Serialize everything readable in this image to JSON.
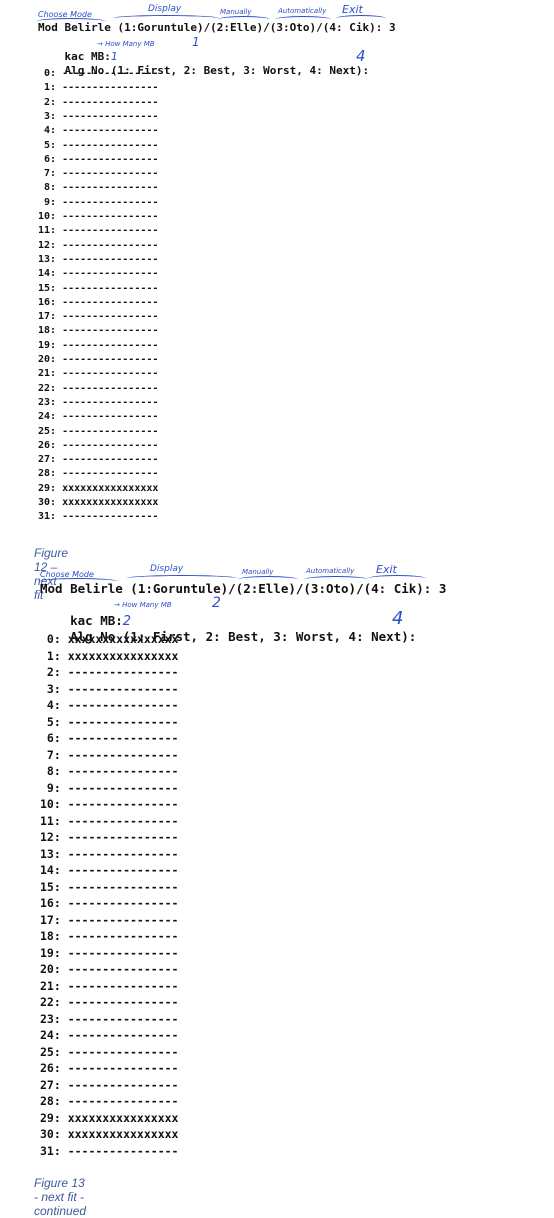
{
  "figures": [
    {
      "annotations": {
        "choose": "Choose Mode",
        "display": "Display",
        "manually": "Manually",
        "automatically": "Automatically",
        "exit": "Exit",
        "how_many": "→ How Many MB"
      },
      "prompt_mode": "Mod Belirle (1:Goruntule)/(2:Elle)/(3:Oto)/(4: Cik): 3",
      "prompt_mb": "kac MB:",
      "mb_answer_1": "1",
      "mb_answer_2": "1",
      "prompt_alg": "Alg No (1: First, 2: Best, 3: Worst, 4: Next):",
      "alg_answer": "4",
      "rows": [
        "0: ----------------",
        "1: ----------------",
        "2: ----------------",
        "3: ----------------",
        "4: ----------------",
        "5: ----------------",
        "6: ----------------",
        "7: ----------------",
        "8: ----------------",
        "9: ----------------",
        "10: ----------------",
        "11: ----------------",
        "12: ----------------",
        "13: ----------------",
        "14: ----------------",
        "15: ----------------",
        "16: ----------------",
        "17: ----------------",
        "18: ----------------",
        "19: ----------------",
        "20: ----------------",
        "21: ----------------",
        "22: ----------------",
        "23: ----------------",
        "24: ----------------",
        "25: ----------------",
        "26: ----------------",
        "27: ----------------",
        "28: ----------------",
        "29: xxxxxxxxxxxxxxxx",
        "30: xxxxxxxxxxxxxxxx",
        "31: ----------------"
      ],
      "caption": "Figure 12 – next fit"
    },
    {
      "annotations": {
        "choose": "Choose Mode",
        "display": "Display",
        "manually": "Manually",
        "automatically": "Automatically",
        "exit": "Exit",
        "how_many": "→ How Many MB"
      },
      "prompt_mode": "Mod Belirle (1:Goruntule)/(2:Elle)/(3:Oto)/(4: Cik): 3",
      "prompt_mb": "kac MB:",
      "mb_answer_1": "2",
      "mb_answer_2": "2",
      "prompt_alg": "Alg No (1: First, 2: Best, 3: Worst, 4: Next):",
      "alg_answer": "4",
      "rows": [
        "0: xxxxxxxxxxxxxxxx",
        "1: xxxxxxxxxxxxxxxx",
        "2: ----------------",
        "3: ----------------",
        "4: ----------------",
        "5: ----------------",
        "6: ----------------",
        "7: ----------------",
        "8: ----------------",
        "9: ----------------",
        "10: ----------------",
        "11: ----------------",
        "12: ----------------",
        "13: ----------------",
        "14: ----------------",
        "15: ----------------",
        "16: ----------------",
        "17: ----------------",
        "18: ----------------",
        "19: ----------------",
        "20: ----------------",
        "21: ----------------",
        "22: ----------------",
        "23: ----------------",
        "24: ----------------",
        "25: ----------------",
        "26: ----------------",
        "27: ----------------",
        "28: ----------------",
        "29: xxxxxxxxxxxxxxxx",
        "30: xxxxxxxxxxxxxxxx",
        "31: ----------------"
      ],
      "caption": "Figure 13 - next fit - continued"
    }
  ]
}
